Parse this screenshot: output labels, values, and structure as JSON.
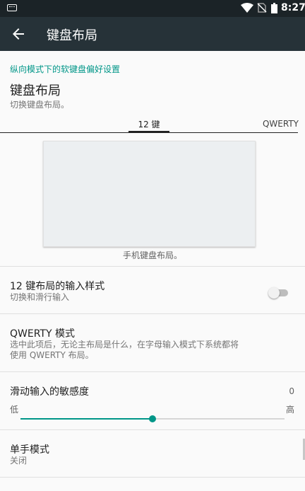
{
  "status_bar": {
    "time": "8:27"
  },
  "toolbar": {
    "title": "键盘布局"
  },
  "category": "纵向模式下的软键盘偏好设置",
  "layout_section": {
    "title": "键盘布局",
    "subtitle": "切换键盘布局。",
    "tabs": [
      {
        "label": "12 键",
        "selected": true
      },
      {
        "label": "QWERTY",
        "selected": false
      }
    ],
    "preview_caption": "手机键盘布局。"
  },
  "prefs": {
    "input_style": {
      "title": "12 键布局的输入样式",
      "summary": "切换和滑行输入"
    },
    "qwerty_mode": {
      "title": "QWERTY 模式",
      "summary_line1": "选中此项后，无论主布局是什么，在字母输入模式下系统都将",
      "summary_line2": "使用 QWERTY 布局。",
      "enabled": false
    },
    "swipe_sensitivity": {
      "title": "滑动输入的敏感度",
      "value": "0",
      "low_label": "低",
      "high_label": "高",
      "level_fraction": 0.5
    },
    "one_hand": {
      "title": "单手模式",
      "summary": "关闭"
    }
  },
  "colors": {
    "accent": "#009688",
    "toolbar": "#263238",
    "status_bar": "#1b2327"
  }
}
